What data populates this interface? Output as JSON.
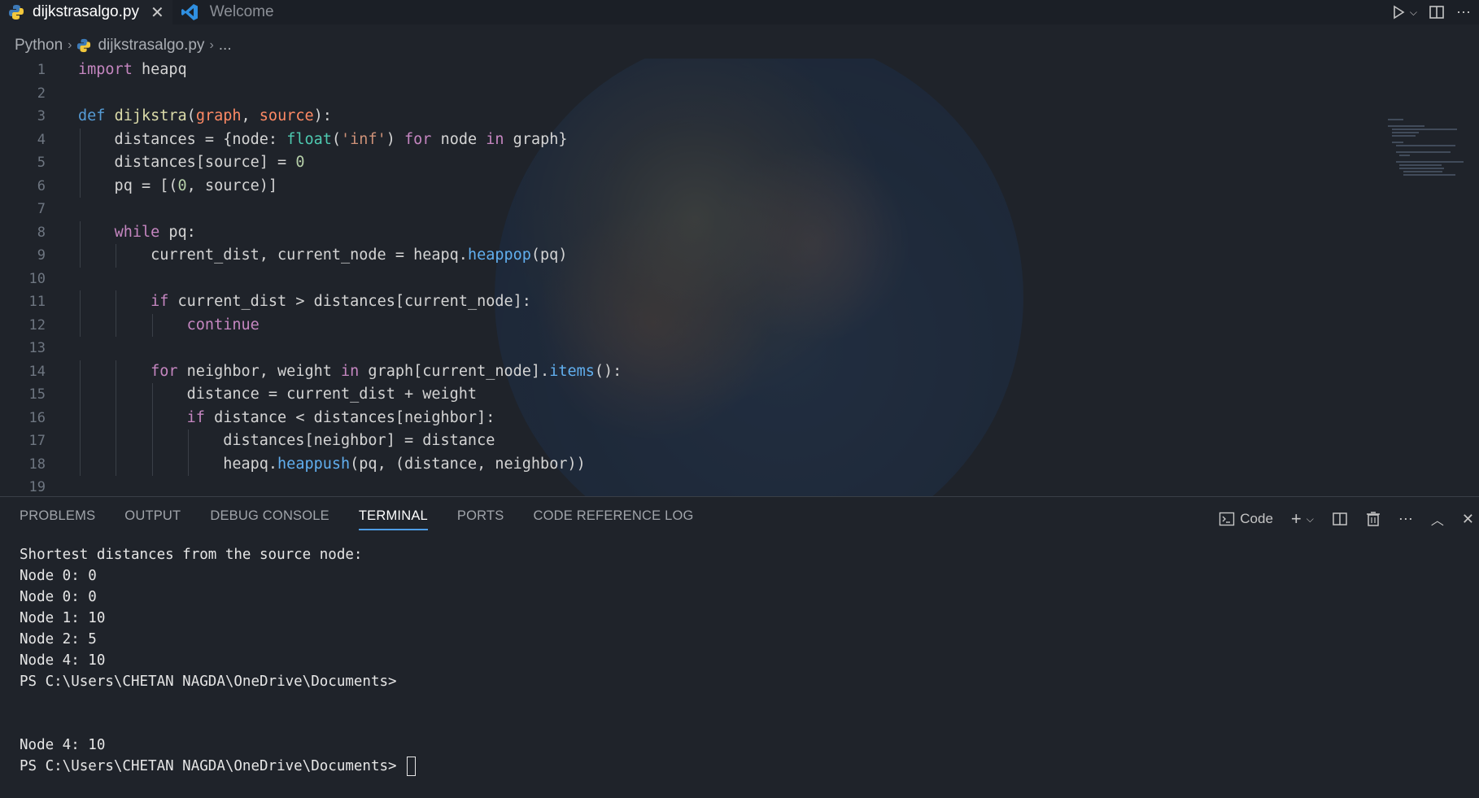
{
  "tabs": [
    {
      "label": "dijkstrasalgo.py",
      "icon": "python-icon",
      "active": true
    },
    {
      "label": "Welcome",
      "icon": "vscode-icon",
      "active": false
    }
  ],
  "breadcrumb": {
    "root": "Python",
    "file": "dijkstrasalgo.py",
    "more": "..."
  },
  "editor": {
    "line_numbers": [
      "1",
      "2",
      "3",
      "4",
      "5",
      "6",
      "7",
      "8",
      "9",
      "10",
      "11",
      "12",
      "13",
      "14",
      "15",
      "16",
      "17",
      "18",
      "19"
    ],
    "lines": [
      "import heapq",
      "",
      "def dijkstra(graph, source):",
      "    distances = {node: float('inf') for node in graph}",
      "    distances[source] = 0",
      "    pq = [(0, source)]",
      "",
      "    while pq:",
      "        current_dist, current_node = heapq.heappop(pq)",
      "",
      "        if current_dist > distances[current_node]:",
      "            continue",
      "",
      "        for neighbor, weight in graph[current_node].items():",
      "            distance = current_dist + weight",
      "            if distance < distances[neighbor]:",
      "                distances[neighbor] = distance",
      "                heapq.heappush(pq, (distance, neighbor))",
      ""
    ]
  },
  "panel": {
    "tabs": [
      "PROBLEMS",
      "OUTPUT",
      "DEBUG CONSOLE",
      "TERMINAL",
      "PORTS",
      "CODE REFERENCE LOG"
    ],
    "active_tab": "TERMINAL",
    "terminal_profile": "Code"
  },
  "terminal": {
    "lines": [
      "Shortest distances from the source node:",
      "Node 0: 0",
      "Node 0: 0",
      "Node 1: 10",
      "Node 2: 5",
      "Node 4: 10",
      "PS C:\\Users\\CHETAN NAGDA\\OneDrive\\Documents>",
      "",
      "",
      "Node 4: 10"
    ],
    "prompt": "PS C:\\Users\\CHETAN NAGDA\\OneDrive\\Documents> "
  },
  "colors": {
    "accent": "#4f9de5",
    "keyword": "#c586c0",
    "function": "#dcdcaa",
    "string": "#ce9178"
  }
}
